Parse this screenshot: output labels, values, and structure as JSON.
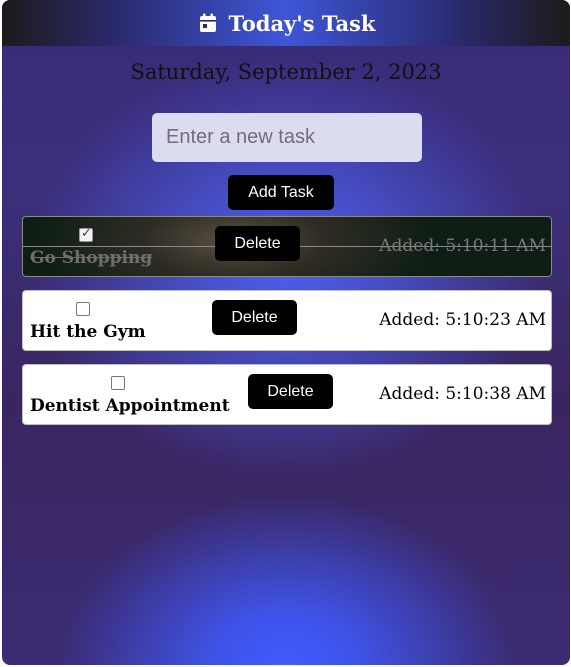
{
  "header": {
    "title": "Today's Task",
    "icon": "calendar-icon"
  },
  "date": "Saturday, September 2, 2023",
  "new_task": {
    "placeholder": "Enter a new task",
    "value": ""
  },
  "add_button_label": "Add Task",
  "tasks": [
    {
      "name": "Go Shopping",
      "completed": true,
      "delete_label": "Delete",
      "added": "Added: 5:10:11 AM"
    },
    {
      "name": "Hit the Gym",
      "completed": false,
      "delete_label": "Delete",
      "added": "Added: 5:10:23 AM"
    },
    {
      "name": "Dentist Appointment",
      "completed": false,
      "delete_label": "Delete",
      "added": "Added: 5:10:38 AM"
    }
  ],
  "colors": {
    "header_text": "#ffffff",
    "button_bg": "#000000",
    "accent_blue": "#3f5bff"
  }
}
